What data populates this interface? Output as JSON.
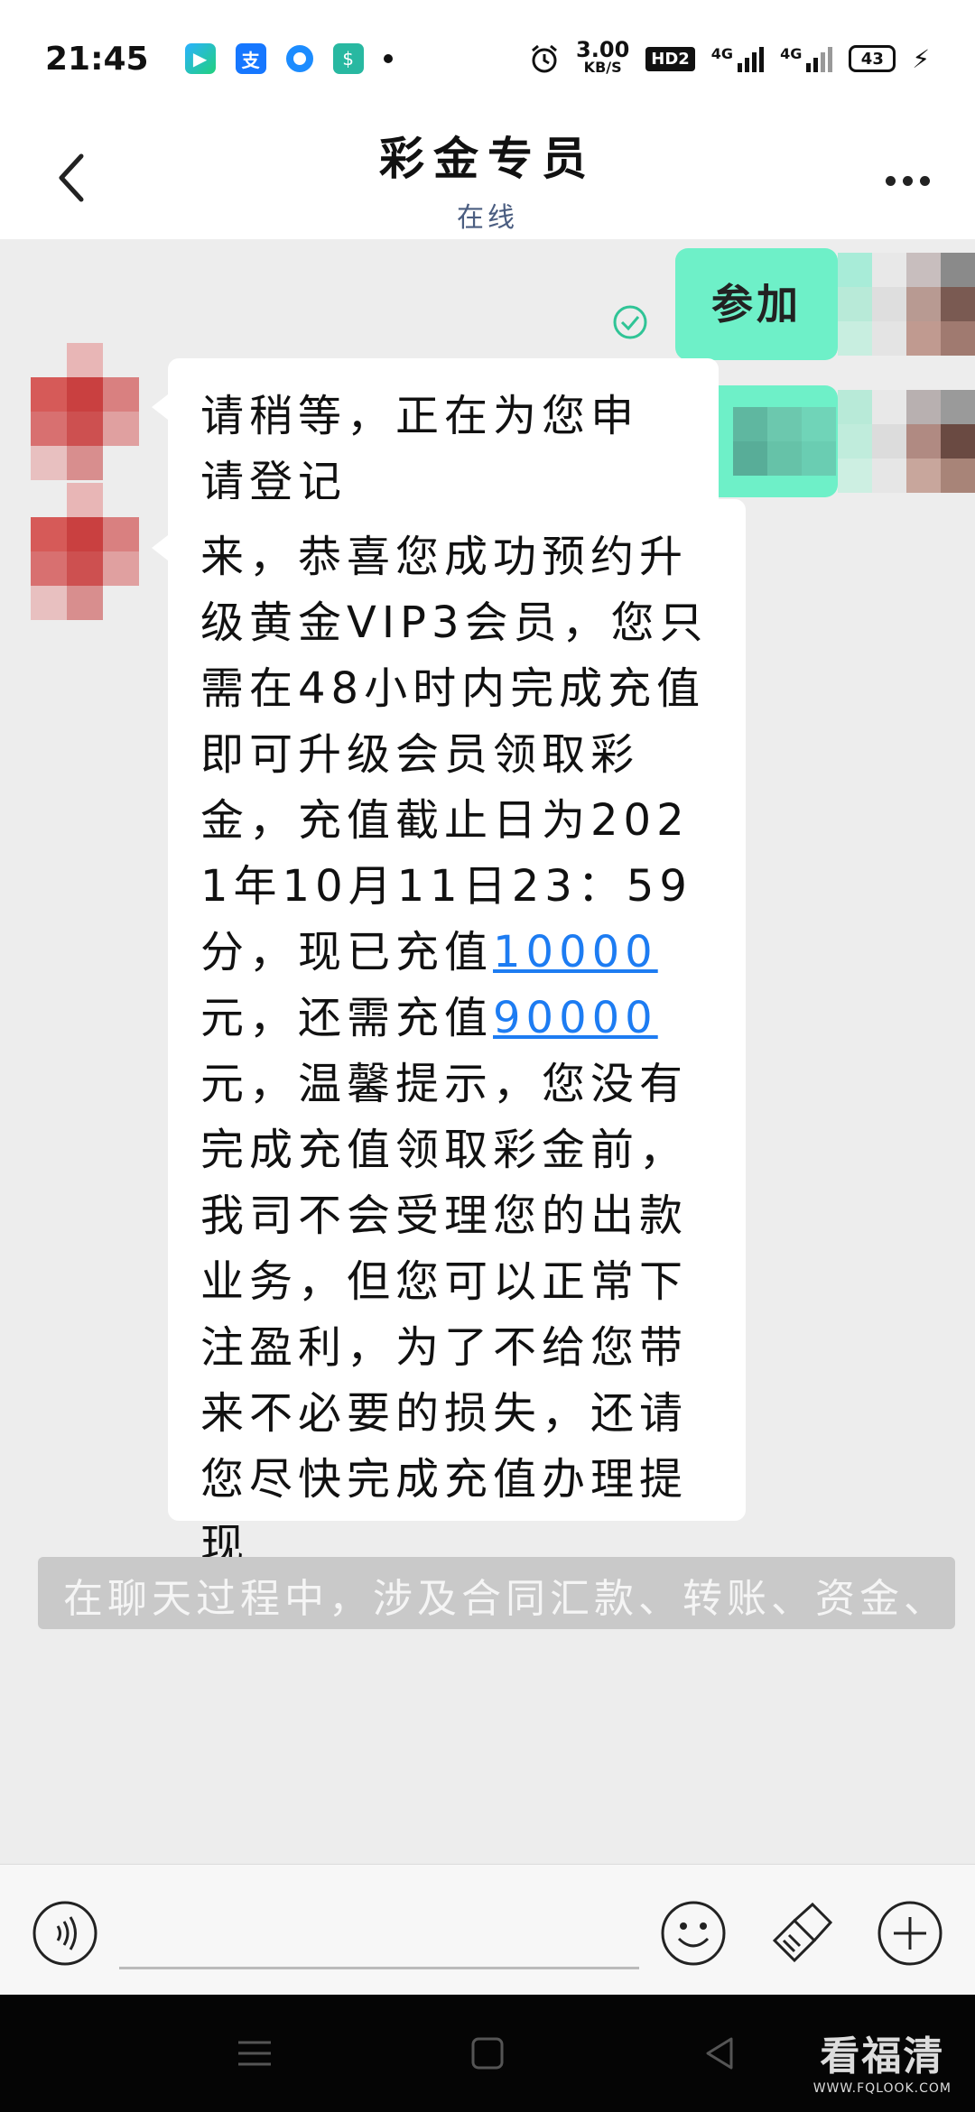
{
  "status_bar": {
    "time": "21:45",
    "alipay_glyph": "支",
    "money_glyph": "$",
    "speed_value": "3.00",
    "speed_unit": "KB/S",
    "hd_badge": "HD2",
    "network_1": "4G",
    "network_2": "4G",
    "battery": "43",
    "icons": [
      "video-app-icon",
      "alipay-icon",
      "circle-app-icon",
      "money-app-icon",
      "alarm-icon",
      "signal-icon",
      "battery-icon",
      "charging-icon"
    ]
  },
  "header": {
    "title": "彩金专员",
    "subtitle": "在线"
  },
  "messages": {
    "out_1": "参加",
    "in_1": "请稍等，正在为您申请登记",
    "in_2": {
      "part_1": "来，恭喜您成功预约升级黄金VIP3会员，您只需在48小时内完成充值即可升级会员领取彩金，充值截止日为2021年10月11日23：59分，现已充值",
      "amount_paid": "10000",
      "part_2": "元，还需充值",
      "amount_due": "90000",
      "part_3": "元，温馨提示，您没有完成充值领取彩金前，我司不会受理您的出款业务，但您可以正常下注盈利，为了不给您带来不必要的损失，还请您尽快完成充值办理提现"
    }
  },
  "notice": {
    "text": "在聊天过程中，涉及合同汇款、转账、资金、"
  },
  "input_bar": {
    "placeholder": ""
  },
  "watermark": {
    "main": "看福清",
    "sub": "WWW.FQLOOK.COM"
  },
  "colors": {
    "outgoing_bubble": "#6ef0c8",
    "link": "#1d7cf2",
    "subtitle": "#4a5d80",
    "check": "#2fc496"
  }
}
